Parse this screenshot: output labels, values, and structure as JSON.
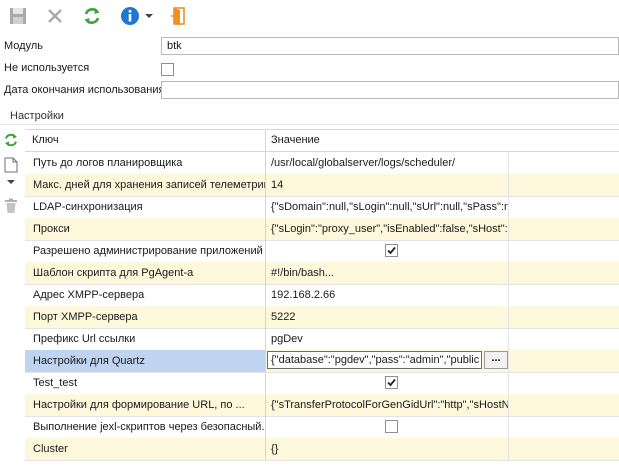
{
  "form": {
    "module_label": "Модуль",
    "module_value": "btk",
    "unused_label": "Не используется",
    "end_date_label": "Дата окончания использования",
    "end_date_value": ""
  },
  "section_title": "Настройки",
  "grid": {
    "col_key": "Ключ",
    "col_value": "Значение",
    "rows": [
      {
        "key": "Путь до логов планировщика",
        "value": "/usr/local/globalserver/logs/scheduler/"
      },
      {
        "key": "Макс. дней для хранения записей телеметрии",
        "value": "14"
      },
      {
        "key": "LDAP-синхронизация",
        "value": "{\"sDomain\":null,\"sLogin\":null,\"sUrl\":null,\"sPass\":n"
      },
      {
        "key": "Прокси",
        "value": "{\"sLogin\":\"proxy_user\",\"isEnabled\":false,\"sHost\":"
      },
      {
        "key": "Разрешено администрирование приложений",
        "value": ""
      },
      {
        "key": "Шаблон скрипта для PgAgent-a",
        "value": "#!/bin/bash..."
      },
      {
        "key": "Адрес XMPP-сервера",
        "value": "192.168.2.66"
      },
      {
        "key": "Порт XMPP-сервера",
        "value": "5222"
      },
      {
        "key": "Префикс Url ссылки",
        "value": "pgDev"
      },
      {
        "key": "Настройки для Quartz",
        "value": "{\"database\":\"pgdev\",\"pass\":\"admin\",\"public"
      },
      {
        "key": "Test_test",
        "value": ""
      },
      {
        "key": "Настройки для формирование URL, по ...",
        "value": "{\"sTransferProtocolForGenGidUrl\":\"http\",\"sHostNa"
      },
      {
        "key": "Выполнение jexl-скриптов через безопасный...",
        "value": ""
      },
      {
        "key": "Cluster",
        "value": "{}"
      }
    ],
    "checkbox_states": {
      "row4": true,
      "row10": true,
      "row12": false
    },
    "editor_button_label": "..."
  },
  "colors": {
    "row_alt": "#fdf8dc",
    "row_selected_key": "#bfd4f0",
    "refresh_green": "#3aa53a",
    "info_blue": "#1e78d2",
    "exit_orange": "#f09020"
  }
}
